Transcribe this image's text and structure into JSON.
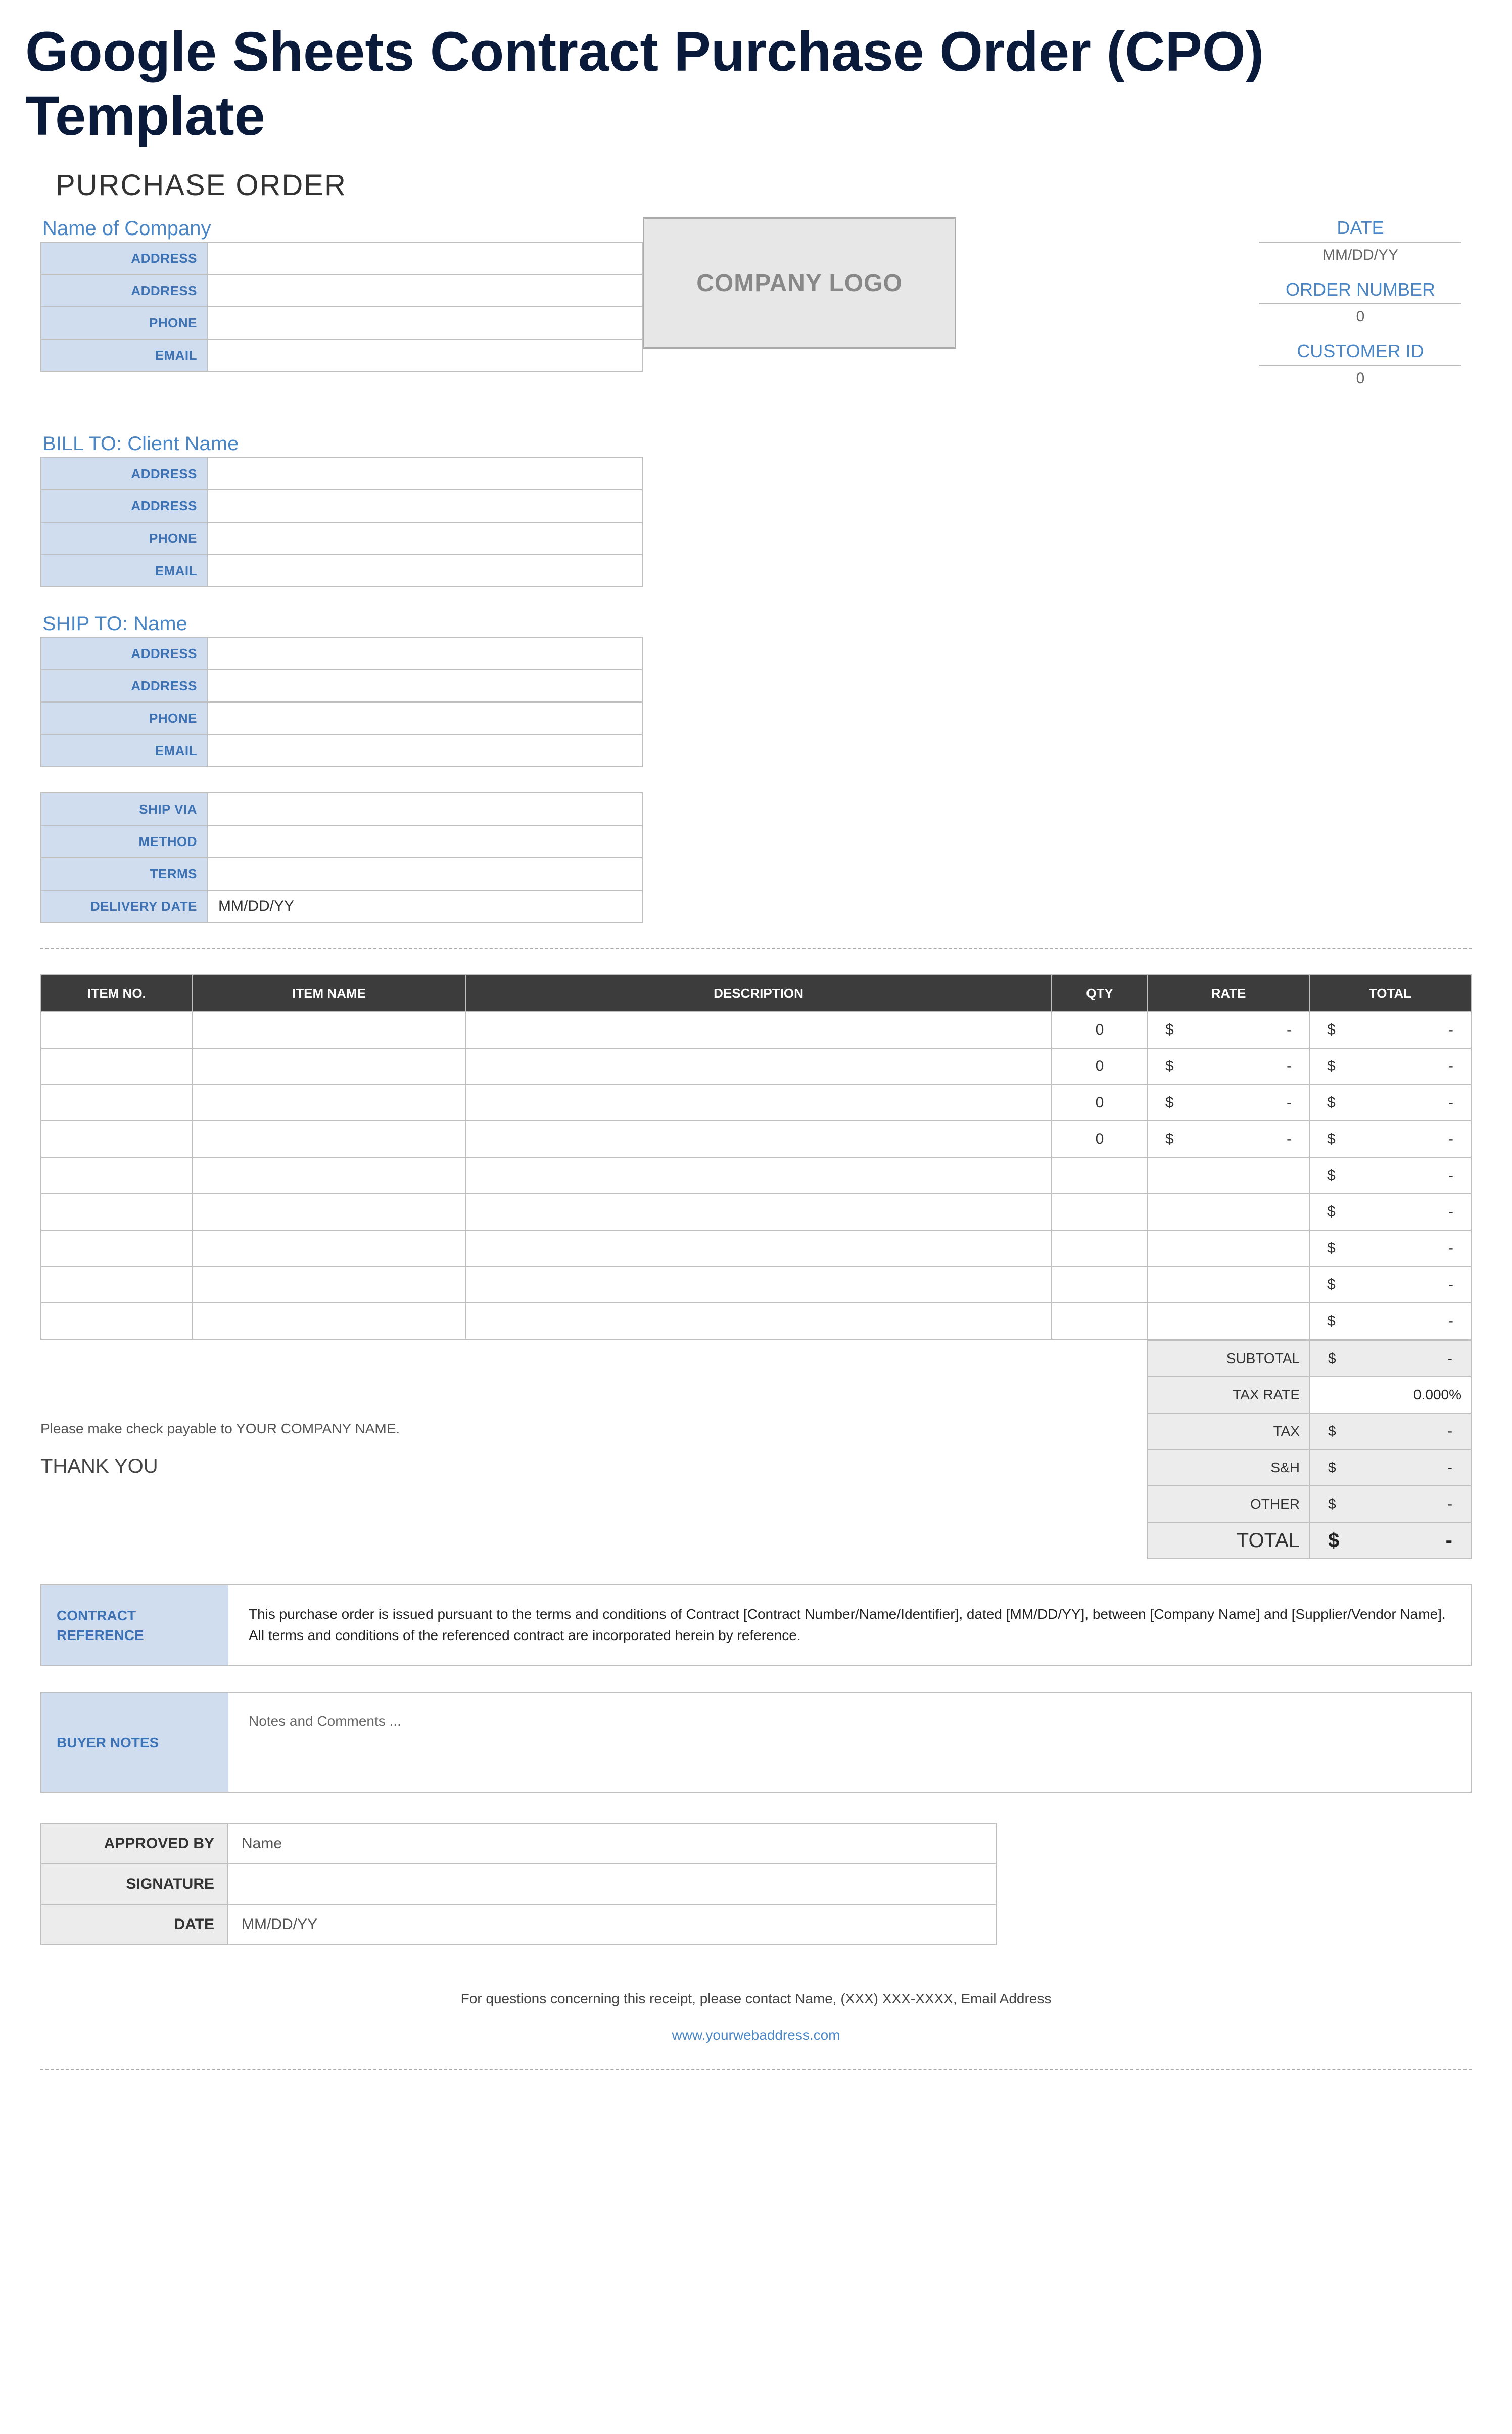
{
  "page_title": "Google Sheets Contract Purchase Order (CPO) Template",
  "heading": "PURCHASE ORDER",
  "company": {
    "title": "Name of Company",
    "fields": [
      {
        "label": "ADDRESS",
        "value": ""
      },
      {
        "label": "ADDRESS",
        "value": ""
      },
      {
        "label": "PHONE",
        "value": ""
      },
      {
        "label": "EMAIL",
        "value": ""
      }
    ]
  },
  "logo_placeholder": "COMPANY LOGO",
  "meta": {
    "date": {
      "label": "DATE",
      "value": "MM/DD/YY"
    },
    "order": {
      "label": "ORDER NUMBER",
      "value": "0"
    },
    "cust": {
      "label": "CUSTOMER ID",
      "value": "0"
    }
  },
  "bill_to": {
    "title": "BILL TO: Client Name",
    "fields": [
      {
        "label": "ADDRESS",
        "value": ""
      },
      {
        "label": "ADDRESS",
        "value": ""
      },
      {
        "label": "PHONE",
        "value": ""
      },
      {
        "label": "EMAIL",
        "value": ""
      }
    ]
  },
  "ship_to": {
    "title": "SHIP TO: Name",
    "fields": [
      {
        "label": "ADDRESS",
        "value": ""
      },
      {
        "label": "ADDRESS",
        "value": ""
      },
      {
        "label": "PHONE",
        "value": ""
      },
      {
        "label": "EMAIL",
        "value": ""
      }
    ]
  },
  "ship_opts": {
    "fields": [
      {
        "label": "SHIP VIA",
        "value": ""
      },
      {
        "label": "METHOD",
        "value": ""
      },
      {
        "label": "TERMS",
        "value": ""
      },
      {
        "label": "DELIVERY DATE",
        "value": "MM/DD/YY"
      }
    ]
  },
  "items": {
    "headers": [
      "ITEM NO.",
      "ITEM NAME",
      "DESCRIPTION",
      "QTY",
      "RATE",
      "TOTAL"
    ],
    "rows": [
      {
        "no": "",
        "name": "",
        "desc": "",
        "qty": "0",
        "rate": "$ -",
        "total": "$ -"
      },
      {
        "no": "",
        "name": "",
        "desc": "",
        "qty": "0",
        "rate": "$ -",
        "total": "$ -"
      },
      {
        "no": "",
        "name": "",
        "desc": "",
        "qty": "0",
        "rate": "$ -",
        "total": "$ -"
      },
      {
        "no": "",
        "name": "",
        "desc": "",
        "qty": "0",
        "rate": "$ -",
        "total": "$ -"
      },
      {
        "no": "",
        "name": "",
        "desc": "",
        "qty": "",
        "rate": "",
        "total": "$ -"
      },
      {
        "no": "",
        "name": "",
        "desc": "",
        "qty": "",
        "rate": "",
        "total": "$ -"
      },
      {
        "no": "",
        "name": "",
        "desc": "",
        "qty": "",
        "rate": "",
        "total": "$ -"
      },
      {
        "no": "",
        "name": "",
        "desc": "",
        "qty": "",
        "rate": "",
        "total": "$ -"
      },
      {
        "no": "",
        "name": "",
        "desc": "",
        "qty": "",
        "rate": "",
        "total": "$ -"
      }
    ]
  },
  "summary": {
    "subtotal": {
      "label": "SUBTOTAL",
      "value": "$ -"
    },
    "tax_rate": {
      "label": "TAX RATE",
      "value": "0.000%"
    },
    "tax": {
      "label": "TAX",
      "value": "$ -"
    },
    "sh": {
      "label": "S&H",
      "value": "$ -"
    },
    "other": {
      "label": "OTHER",
      "value": "$ -"
    },
    "total": {
      "label": "TOTAL",
      "value": "$ -"
    }
  },
  "payable_note": "Please make check payable to YOUR COMPANY NAME.",
  "thank_you": "THANK YOU",
  "contract": {
    "label": "CONTRACT REFERENCE",
    "text": "This purchase order is issued pursuant to the terms and conditions of Contract [Contract Number/Name/Identifier], dated [MM/DD/YY], between [Company Name] and [Supplier/Vendor Name]. All terms and conditions of the referenced contract are incorporated herein by reference."
  },
  "buyer_notes": {
    "label": "BUYER NOTES",
    "text": "Notes and Comments ..."
  },
  "approval": {
    "fields": [
      {
        "label": "APPROVED BY",
        "value": "Name"
      },
      {
        "label": "SIGNATURE",
        "value": ""
      },
      {
        "label": "DATE",
        "value": "MM/DD/YY"
      }
    ]
  },
  "footer": {
    "line": "For questions concerning this receipt, please contact Name, (XXX) XXX-XXXX, Email Address",
    "web": "www.yourwebaddress.com"
  }
}
